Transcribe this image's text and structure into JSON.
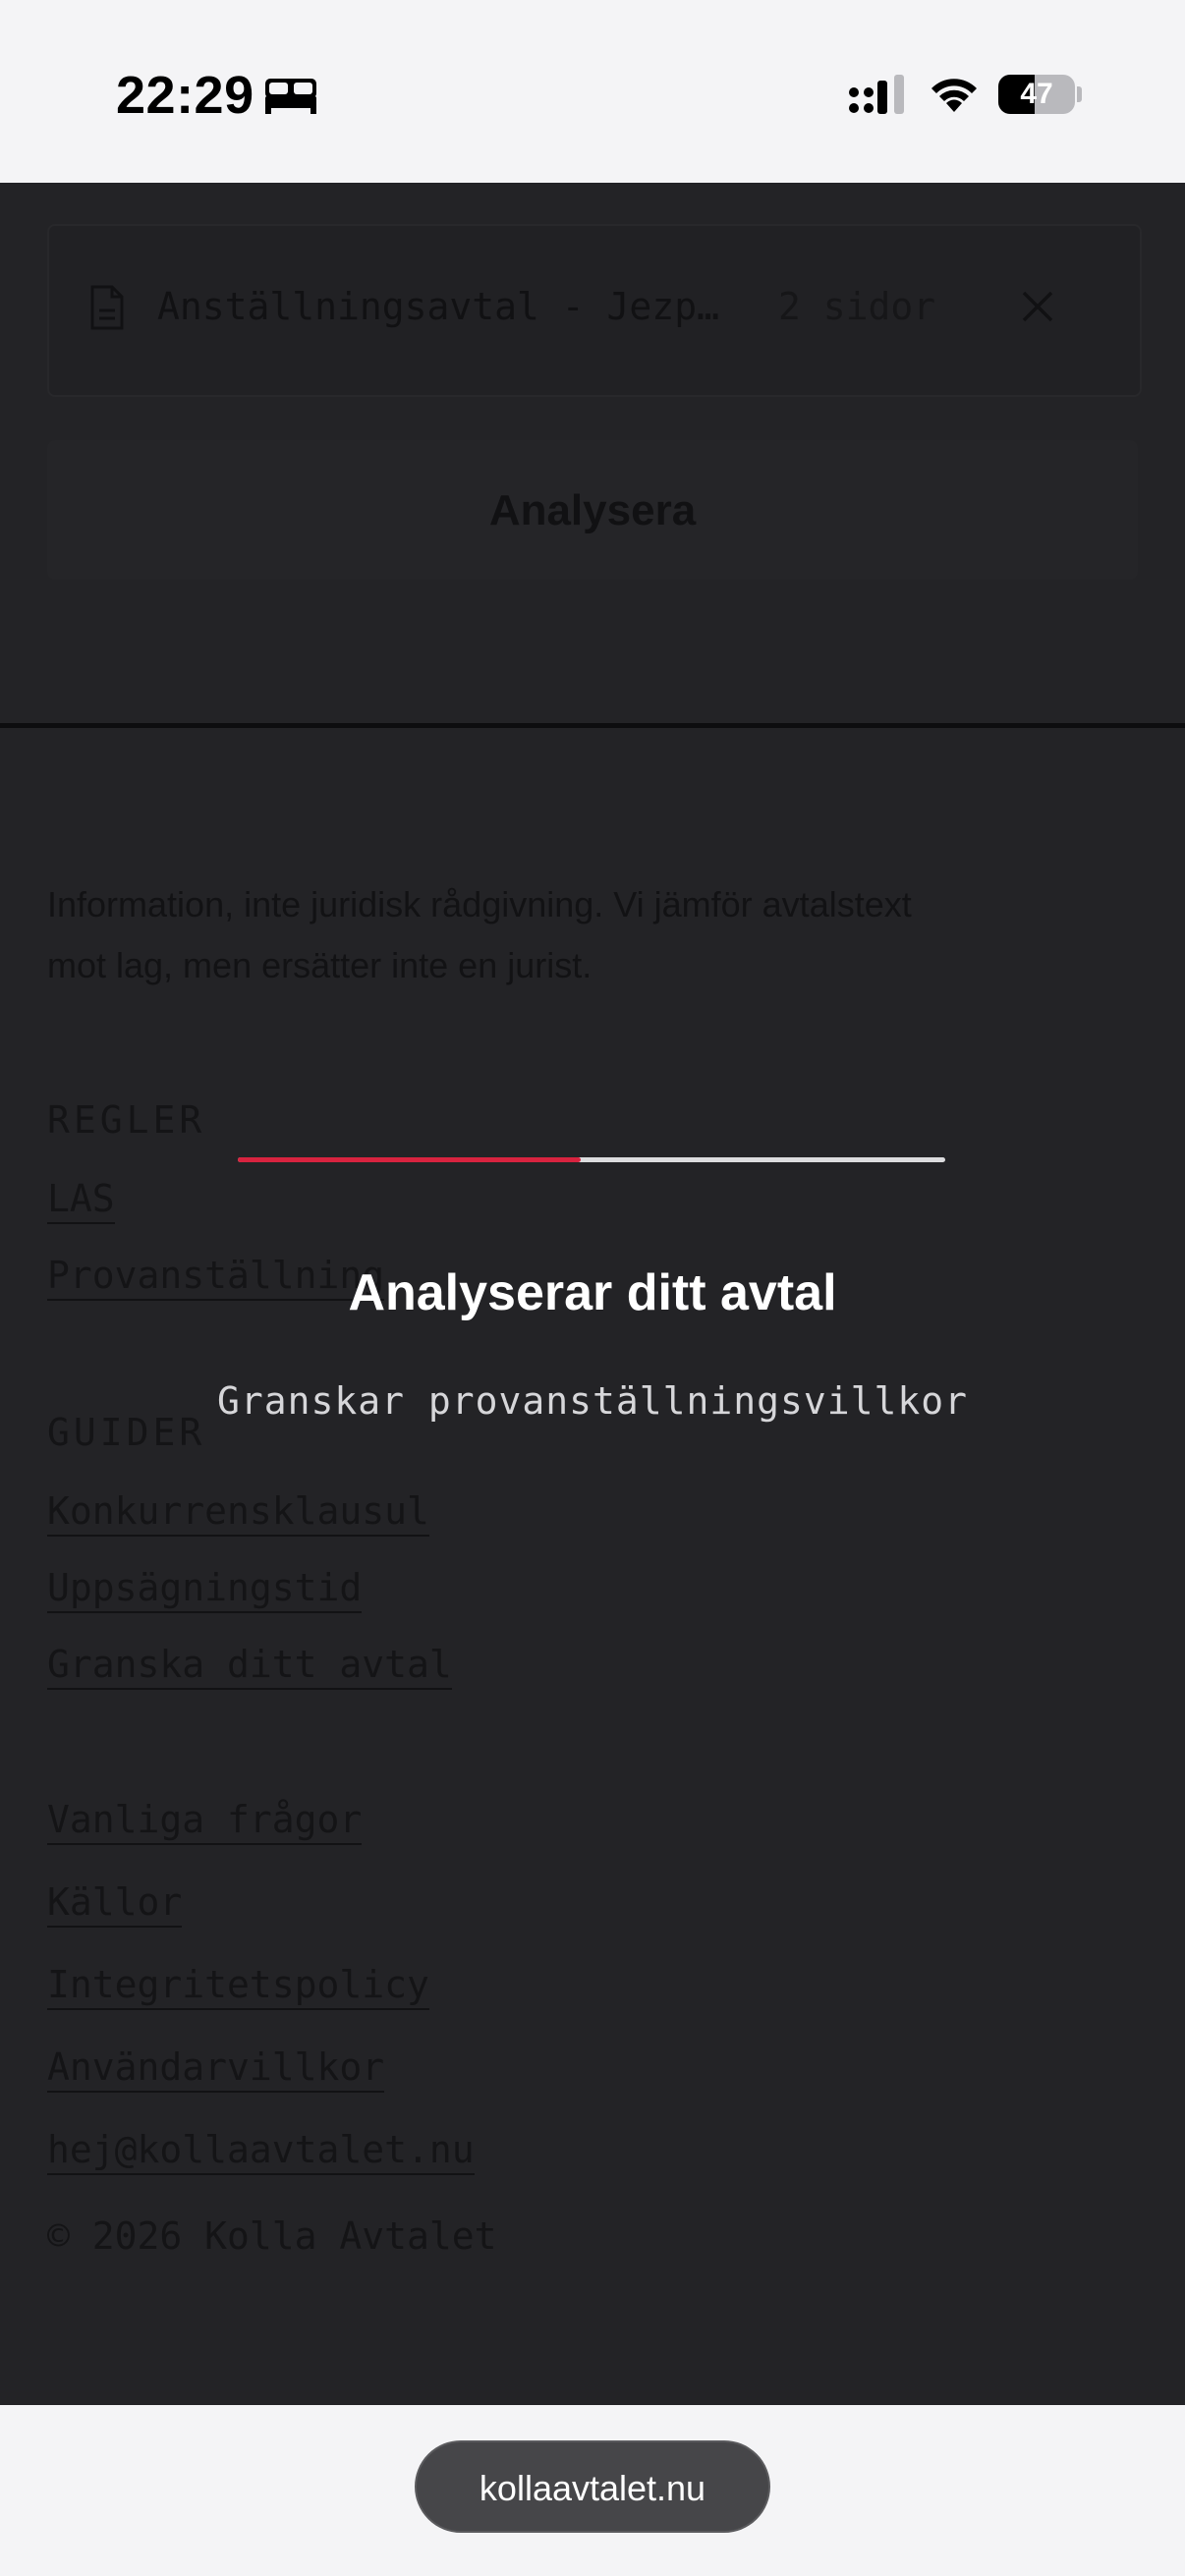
{
  "status_bar": {
    "time": "22:29",
    "focus_icon": "bed-icon",
    "battery_level": "47",
    "battery_fraction": 0.47
  },
  "upload": {
    "file_name": "Anställningsavtal - Jezp…",
    "page_count": "2 sidor"
  },
  "analyze_button": {
    "label": "Analysera"
  },
  "footer": {
    "disclaimer": "Information, inte juridisk rådgivning. Vi jämför avtalstext mot lag, men ersätter inte en jurist.",
    "rules_heading": "REGLER",
    "rules": [
      "LAS",
      "Provanställning"
    ],
    "guides_heading": "GUIDER",
    "guides": [
      "Konkurrensklausul",
      "Uppsägningstid",
      "Granska ditt avtal"
    ],
    "links": [
      "Vanliga frågor",
      "Källor",
      "Integritetspolicy",
      "Användarvillkor",
      "hej@kollaavtalet.nu"
    ],
    "copyright": "© 2026 Kolla Avtalet"
  },
  "overlay": {
    "progress_fraction": 0.485,
    "title": "Analyserar ditt avtal",
    "status": "Granskar provanställningsvillkor"
  },
  "browser": {
    "url": "kollaavtalet.nu"
  },
  "colors": {
    "accent": "#d8233f",
    "overlay_bg": "#232326",
    "chrome_bg": "#f4f4f6"
  }
}
